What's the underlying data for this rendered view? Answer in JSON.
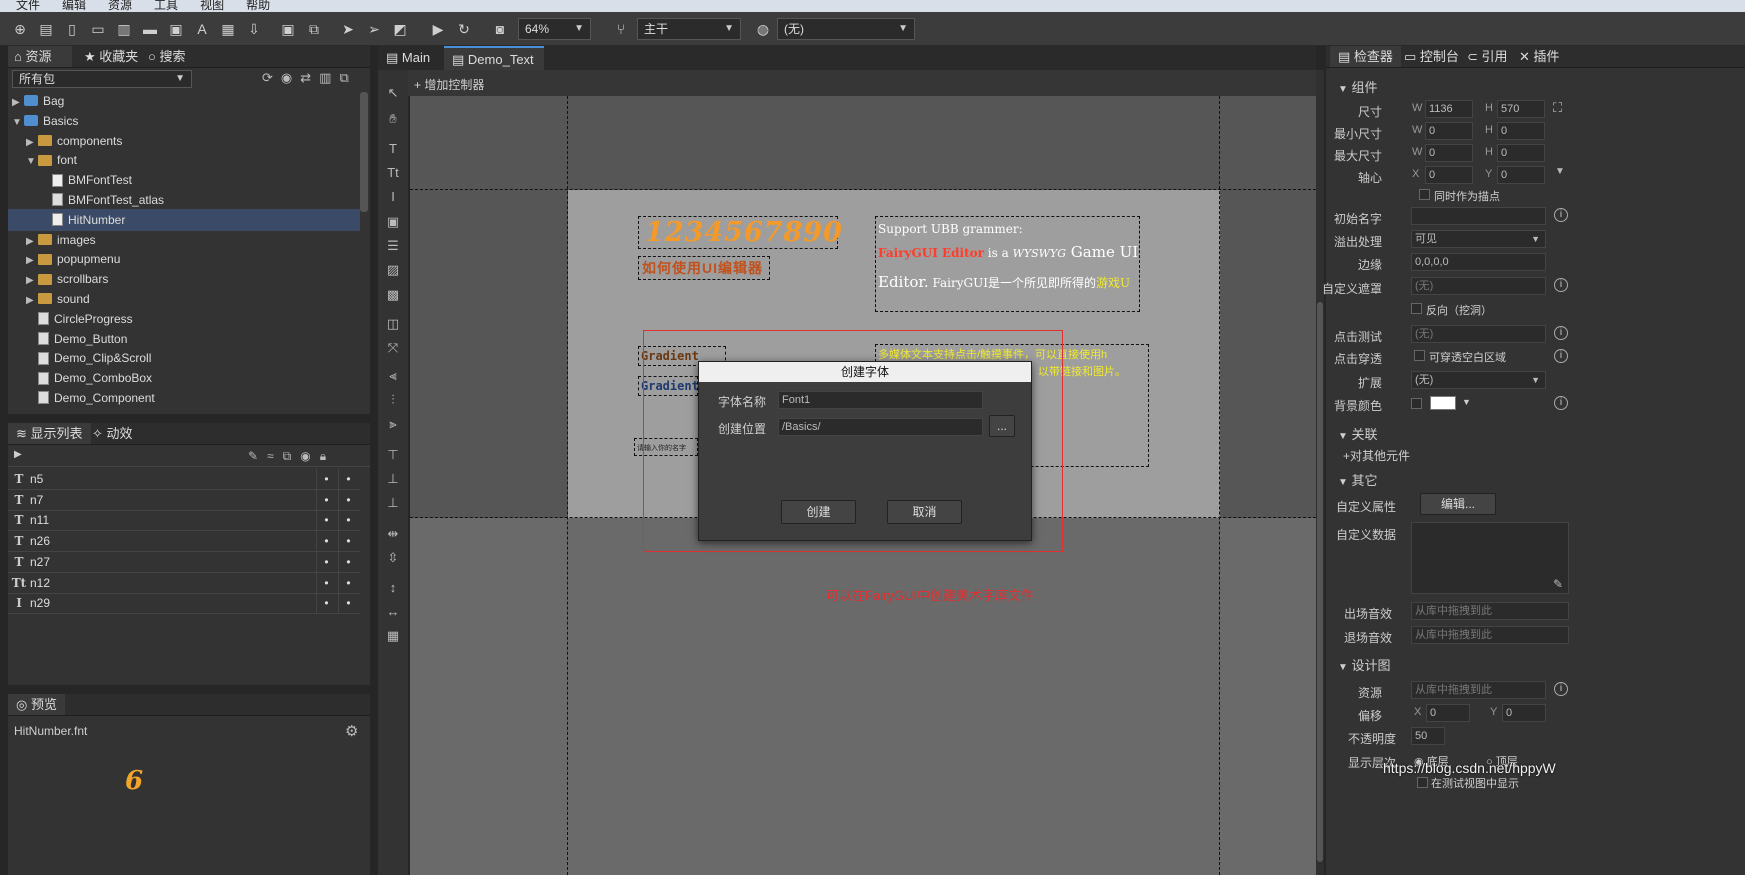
{
  "menu": [
    "文件",
    "编辑",
    "资源",
    "工具",
    "视图",
    "帮助"
  ],
  "toolbar": {
    "zoom": "64%",
    "branch": "主干",
    "lang": "(无)"
  },
  "left": {
    "tabs": {
      "library": "资源库",
      "favorites": "收藏夹",
      "search": "搜索"
    },
    "pkg_filter": "所有包",
    "tree": [
      {
        "label": "Bag",
        "type": "pkg",
        "indent": 0,
        "arrow": "▶"
      },
      {
        "label": "Basics",
        "type": "pkg",
        "indent": 0,
        "arrow": "▼"
      },
      {
        "label": "components",
        "type": "folder",
        "indent": 1,
        "arrow": "▶"
      },
      {
        "label": "font",
        "type": "folder",
        "indent": 1,
        "arrow": "▼"
      },
      {
        "label": "BMFontTest",
        "type": "font",
        "indent": 2,
        "arrow": ""
      },
      {
        "label": "BMFontTest_atlas",
        "type": "doc",
        "indent": 2,
        "arrow": ""
      },
      {
        "label": "HitNumber",
        "type": "font",
        "indent": 2,
        "arrow": ""
      },
      {
        "label": "images",
        "type": "folder",
        "indent": 1,
        "arrow": "▶"
      },
      {
        "label": "popupmenu",
        "type": "folder",
        "indent": 1,
        "arrow": "▶"
      },
      {
        "label": "scrollbars",
        "type": "folder",
        "indent": 1,
        "arrow": "▶"
      },
      {
        "label": "sound",
        "type": "folder",
        "indent": 1,
        "arrow": "▶"
      },
      {
        "label": "CircleProgress",
        "type": "doc",
        "indent": 1,
        "arrow": ""
      },
      {
        "label": "Demo_Button",
        "type": "doc",
        "indent": 1,
        "arrow": ""
      },
      {
        "label": "Demo_Clip&Scroll",
        "type": "doc",
        "indent": 1,
        "arrow": ""
      },
      {
        "label": "Demo_ComboBox",
        "type": "doc",
        "indent": 1,
        "arrow": ""
      },
      {
        "label": "Demo_Component",
        "type": "doc",
        "indent": 1,
        "arrow": ""
      }
    ],
    "display_tabs": {
      "list": "显示列表",
      "anim": "动效"
    },
    "display_list": [
      {
        "name": "n5",
        "icon": "T"
      },
      {
        "name": "n7",
        "icon": "T"
      },
      {
        "name": "n11",
        "icon": "T"
      },
      {
        "name": "n26",
        "icon": "T"
      },
      {
        "name": "n27",
        "icon": "T"
      },
      {
        "name": "n12",
        "icon": "Tt"
      },
      {
        "name": "n29",
        "icon": "I"
      }
    ],
    "preview_tab": "预览",
    "preview_file": "HitNumber.fnt",
    "preview_glyph": "6"
  },
  "center": {
    "tabs": {
      "main": "Main",
      "demo": "Demo_Text"
    },
    "add_controller": "增加控制器",
    "canvas_texts": {
      "digits": "1234567890",
      "howto": "如何使用UI编辑器",
      "gradient1": "Gradient Text",
      "gradient2": "Gradient",
      "input_hint": "请输入你的名字",
      "ubb1": "Support UBB grammer:",
      "ubb2a": "FairyGUI Editor",
      "ubb2b": " is a ",
      "ubb2c": "WYSWYG",
      "ubb2d": " Game UI",
      "ubb3a": "Editor.",
      "ubb3b": " FairyGUI是一个所见即所得的",
      "ubb3c": "游戏U",
      "rich1": "多媒体文本支持点击/触摸事件，可以直接使用h",
      "rich2": "以带链接和图片。",
      "annotation": "可以在FairyGUI中创建美术字库文件"
    },
    "dialog": {
      "title": "创建字体",
      "name_label": "字体名称",
      "name_value": "Font1",
      "loc_label": "创建位置",
      "loc_value": "/Basics/",
      "browse": "...",
      "create": "创建",
      "cancel": "取消"
    }
  },
  "right": {
    "tabs": {
      "inspector": "检查器",
      "console": "控制台",
      "ref": "引用",
      "plugins": "插件"
    },
    "sec_component": "组件",
    "size_label": "尺寸",
    "w": "1136",
    "h": "570",
    "min_label": "最小尺寸",
    "min_w": "0",
    "min_h": "0",
    "max_label": "最大尺寸",
    "max_w": "0",
    "max_h": "0",
    "pivot_label": "轴心",
    "px": "0",
    "py": "0",
    "anchor": "同时作为描点",
    "initname_label": "初始名字",
    "overflow_label": "溢出处理",
    "overflow": "可见",
    "margin_label": "边缘",
    "margin": "0,0,0,0",
    "mask_label": "自定义遮罩",
    "mask": "(无)",
    "reverse": "反向（挖洞）",
    "hittest_label": "点击测试",
    "hittest": "(无)",
    "passthrough_label": "点击穿透",
    "passthrough": "可穿透空白区域",
    "ext_label": "扩展",
    "ext": "(无)",
    "bg_label": "背景颜色",
    "sec_relations": "关联",
    "relations_add": "对其他元件",
    "sec_other": "其它",
    "custom_prop_label": "自定义属性",
    "custom_prop_btn": "编辑...",
    "custom_data_label": "自定义数据",
    "enter_sound_label": "出场音效",
    "enter_sound": "从库中拖拽到此",
    "exit_sound_label": "退场音效",
    "exit_sound": "从库中拖拽到此",
    "sec_design": "设计图",
    "res_label": "资源",
    "res": "从库中拖拽到此",
    "offset_label": "偏移",
    "ox": "0",
    "oy": "0",
    "opacity_label": "不透明度",
    "opacity": "50",
    "layer_label": "显示层次",
    "layer_bottom": "底层",
    "layer_top": "顶层",
    "test_show": "在测试视图中显示"
  },
  "watermark": "https://blog.csdn.net/hppyW",
  "colors": {
    "accent": "#3b4a66",
    "selection": "#e03030"
  }
}
